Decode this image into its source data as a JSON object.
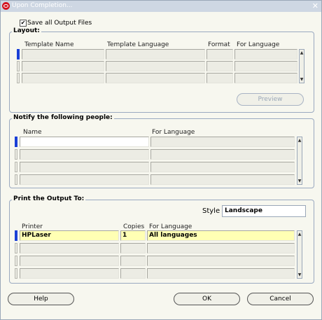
{
  "window": {
    "title": "Upon Completion...",
    "close_glyph": "✕"
  },
  "save_files": {
    "label": "Save all Output Files",
    "checked": true,
    "check_glyph": "✔"
  },
  "layout": {
    "legend": "Layout:",
    "columns": [
      "Template Name",
      "Template Language",
      "Format",
      "For Language"
    ],
    "rows": [
      [
        "",
        "",
        "",
        ""
      ],
      [
        "",
        "",
        "",
        ""
      ],
      [
        "",
        "",
        "",
        ""
      ]
    ],
    "preview_button": "Preview"
  },
  "notify": {
    "legend": "Notify the following people:",
    "columns": [
      "Name",
      "For Language"
    ],
    "rows": [
      [
        "",
        ""
      ],
      [
        "",
        ""
      ],
      [
        "",
        ""
      ],
      [
        "",
        ""
      ]
    ]
  },
  "print": {
    "legend": "Print the Output To:",
    "style_label": "Style",
    "style_value": "Landscape",
    "columns": [
      "Printer",
      "Copies",
      "For Language"
    ],
    "rows": [
      [
        "HPLaser",
        "1",
        "All languages"
      ],
      [
        "",
        "",
        ""
      ],
      [
        "",
        "",
        ""
      ],
      [
        "",
        "",
        ""
      ]
    ]
  },
  "buttons": {
    "help": "Help",
    "ok": "OK",
    "cancel": "Cancel"
  },
  "colors": {
    "titlebar": "#ced7e3",
    "active_row_marker": "#1a3fd6",
    "selected_row": "#ffffb4"
  }
}
